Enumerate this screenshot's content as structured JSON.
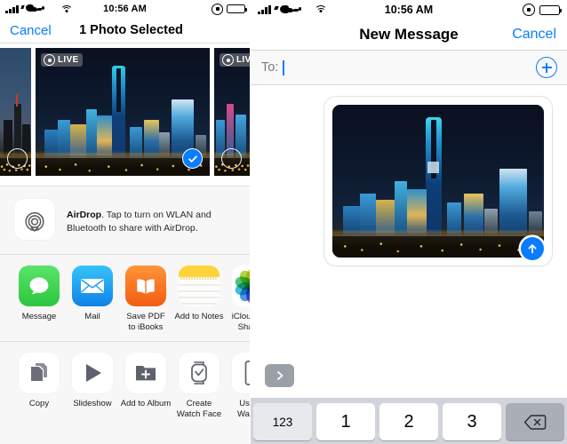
{
  "share_sheet": {
    "statusbar": {
      "time": "10:56 AM",
      "signal_icon": "cellular-signal-icon",
      "carrier_icon": "carrier-logo-icon",
      "wifi_icon": "wifi-icon",
      "rotation_lock_icon": "rotation-lock-icon",
      "battery_icon": "battery-icon"
    },
    "navbar": {
      "cancel_label": "Cancel",
      "title": "1 Photo Selected"
    },
    "photos": [
      {
        "name": "photo-thumb-previous",
        "live": false,
        "selected": false,
        "partial": "left"
      },
      {
        "name": "photo-thumb-selected",
        "live": true,
        "live_label": "LIVE",
        "selected": true,
        "partial": "none"
      },
      {
        "name": "photo-thumb-next",
        "live": true,
        "live_label": "LIVE",
        "selected": false,
        "partial": "right"
      }
    ],
    "airdrop": {
      "icon": "airdrop-icon",
      "title": "AirDrop",
      "description": ". Tap to turn on WLAN and Bluetooth to share with AirDrop."
    },
    "apps": [
      {
        "label": "Message",
        "icon": "messages-app-icon",
        "color": "#4cd964"
      },
      {
        "label": "Mail",
        "icon": "mail-app-icon",
        "color": "#1d9bf6"
      },
      {
        "label": "Save PDF\nto iBooks",
        "label_line1": "Save PDF",
        "label_line2": "to iBooks",
        "icon": "ibooks-app-icon",
        "color": "#f4731c"
      },
      {
        "label": "Add to Notes",
        "icon": "notes-app-icon",
        "color": "#ffd60a"
      },
      {
        "label": "iCloud Photo\nSharing",
        "label_line1": "iCloud Pho",
        "label_line2": "Sharing",
        "icon": "photos-app-icon",
        "color": "#ffffff"
      }
    ],
    "actions": [
      {
        "label": "Copy",
        "icon": "copy-icon"
      },
      {
        "label": "Slideshow",
        "icon": "slideshow-play-icon"
      },
      {
        "label": "Add to Album",
        "icon": "add-to-album-icon"
      },
      {
        "label_line1": "Create",
        "label_line2": "Watch Face",
        "label": "Create Watch Face",
        "icon": "watch-face-icon"
      },
      {
        "label_line1": "Use as",
        "label_line2": "Wallpap",
        "label": "Use as Wallpaper",
        "icon": "wallpaper-phone-icon"
      }
    ]
  },
  "messages": {
    "statusbar": {
      "time": "10:56 AM",
      "signal_icon": "cellular-signal-icon",
      "carrier_icon": "carrier-logo-icon",
      "wifi_icon": "wifi-icon",
      "rotation_lock_icon": "rotation-lock-icon",
      "battery_icon": "battery-icon"
    },
    "navbar": {
      "title": "New Message",
      "cancel_label": "Cancel"
    },
    "to_field": {
      "label": "To:",
      "value": "",
      "add_contact_icon": "add-contact-plus-icon"
    },
    "attachment": {
      "name": "photo-attachment",
      "expand_icon": "expand-chevron-right-icon",
      "send_icon": "send-arrow-up-icon"
    },
    "keyboard": {
      "keys": [
        {
          "label": "123",
          "name": "key-123",
          "style": "special"
        },
        {
          "label": "1",
          "name": "key-1",
          "style": "normal"
        },
        {
          "label": "2",
          "name": "key-2",
          "style": "normal"
        },
        {
          "label": "3",
          "name": "key-3",
          "style": "normal"
        },
        {
          "label": "",
          "name": "key-backspace",
          "style": "dark",
          "icon": "backspace-delete-icon"
        }
      ]
    }
  },
  "colors": {
    "accent_blue": "#0a7cff",
    "keyboard_bg": "#d1d4da",
    "sheet_bg": "#f7f7f7"
  }
}
